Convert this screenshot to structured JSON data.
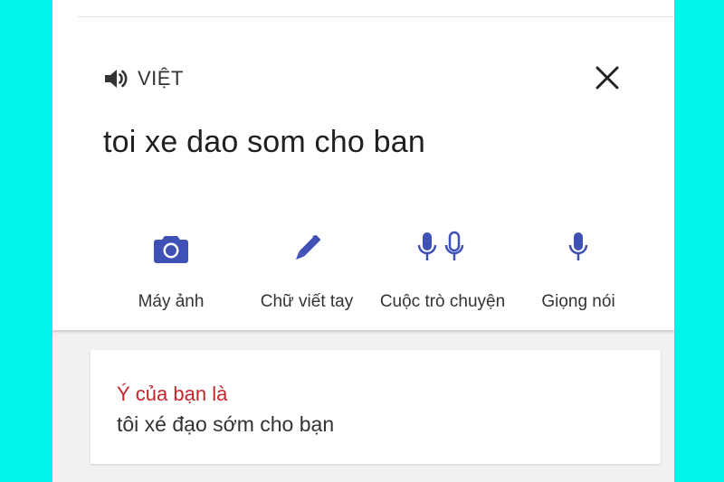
{
  "colors": {
    "background": "#00f5e8",
    "accent": "#3f51b5",
    "suggestion_heading": "#c2262b"
  },
  "source_language": {
    "icon": "speaker-icon",
    "label": "VIỆT"
  },
  "close_icon": "close-icon",
  "input_text": "toi xe dao som cho ban",
  "tools": [
    {
      "icon": "camera-icon",
      "label": "Máy ảnh"
    },
    {
      "icon": "pen-icon",
      "label": "Chữ viết tay"
    },
    {
      "icon": "double-mic-icon",
      "label": "Cuộc trò chuyện"
    },
    {
      "icon": "mic-icon",
      "label": "Giọng nói"
    }
  ],
  "suggestion": {
    "heading": "Ý của bạn là",
    "text": "tôi xé đạo sớm cho bạn"
  }
}
